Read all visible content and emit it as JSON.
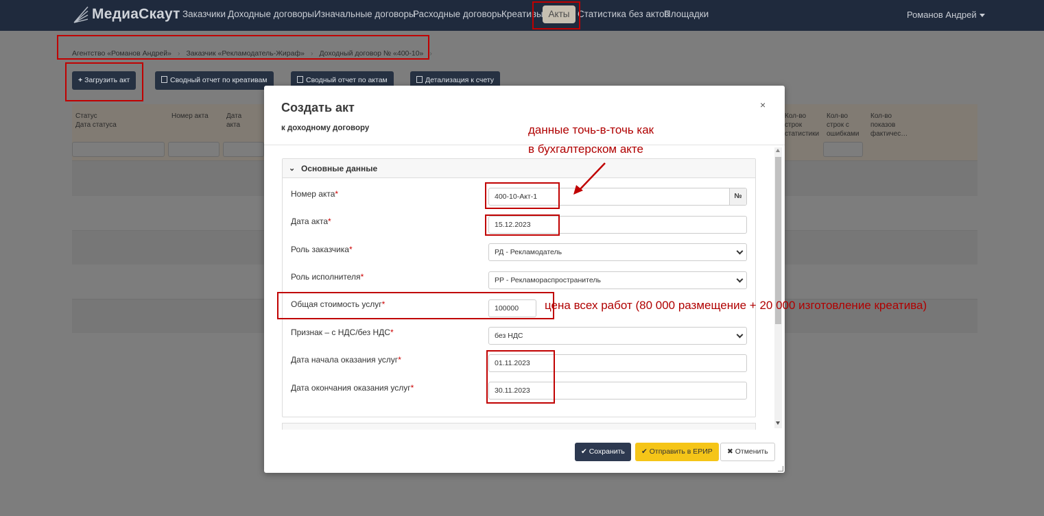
{
  "navbar": {
    "brand": "МедиаСкаут",
    "items": [
      "Заказчики",
      "Доходные договоры",
      "Изначальные договоры",
      "Расходные договоры",
      "Креативы",
      "Акты",
      "Статистика без актов",
      "Площадки"
    ],
    "active": "Акты",
    "user": "Романов Андрей"
  },
  "breadcrumbs": [
    "Агентство «Романов Андрей»",
    "Заказчик «Рекламодатель-Жираф»",
    "Доходный договор № «400-10»"
  ],
  "toolbar": {
    "upload_act": "Загрузить акт",
    "report_creatives": "Сводный отчет по креативам",
    "report_acts": "Сводный отчет по актам",
    "invoice_details": "Детализация к счету"
  },
  "table": {
    "headers_left": [
      [
        "Статус",
        "Дата статуса"
      ],
      [
        "Номер акта"
      ],
      [
        "Дата",
        "акта"
      ]
    ],
    "headers_right": [
      [
        "Кол-во",
        "строк",
        "статистики"
      ],
      [
        "Кол-во",
        "строк с",
        "ошибками"
      ],
      [
        "Кол-во",
        "показов",
        "фактичес…"
      ]
    ]
  },
  "modal": {
    "title": "Создать акт",
    "subtitle": "к доходному договору",
    "close": "×",
    "section_main": "Основные данные",
    "fields": {
      "act_number": {
        "label": "Номер акта",
        "value": "400-10-Акт-1",
        "num_button": "№"
      },
      "act_date": {
        "label": "Дата акта",
        "value": "15.12.2023"
      },
      "customer_role": {
        "label": "Роль заказчика",
        "value": "РД - Рекламодатель"
      },
      "executor_role": {
        "label": "Роль исполнителя",
        "value": "РР - Рекламораспространитель"
      },
      "total_cost": {
        "label": "Общая стоимость услуг",
        "value": "100000"
      },
      "vat_flag": {
        "label": "Признак – с НДС/без НДС",
        "value": "без НДС"
      },
      "start_date": {
        "label": "Дата начала оказания услуг",
        "value": "01.11.2023"
      },
      "end_date": {
        "label": "Дата окончания оказания услуг",
        "value": "30.11.2023"
      }
    },
    "required_mark": "*",
    "buttons": {
      "save": "Сохранить",
      "send": "Отправить в ЕРИР",
      "cancel": "Отменить"
    }
  },
  "annotations": {
    "exact_data_line1": "данные точь-в-точь как",
    "exact_data_line2": "в бухгалтерском акте",
    "price_note": "цена всех работ (80 000 размещение + 20 000 изготовление креатива)",
    "color": "#c00000"
  }
}
